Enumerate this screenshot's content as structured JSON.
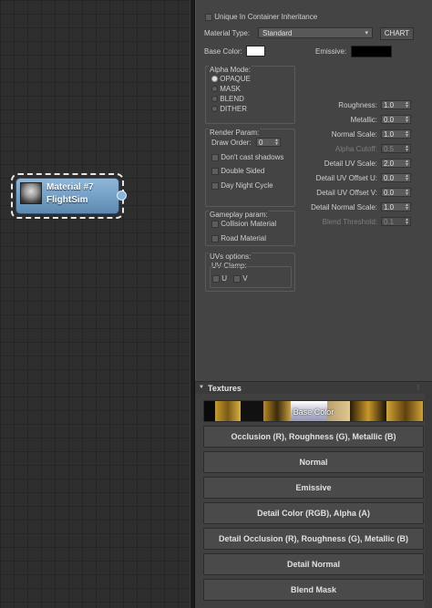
{
  "node": {
    "line1": "Material #7",
    "line2": "FlightSim"
  },
  "panel": {
    "unique_label": "Unique In Container Inheritance",
    "material_type_label": "Material Type:",
    "material_type_value": "Standard",
    "chart_button": "CHART",
    "base_color_label": "Base Color:",
    "base_color": "#ffffff",
    "emissive_label": "Emissive:",
    "emissive_color": "#000000",
    "alpha_mode": {
      "title": "Alpha Mode:",
      "options": [
        "OPAQUE",
        "MASK",
        "BLEND",
        "DITHER"
      ],
      "selected": "OPAQUE"
    },
    "render_param": {
      "title": "Render Param:",
      "draw_order_label": "Draw Order:",
      "draw_order_value": "0",
      "checks": [
        "Don't cast shadows",
        "Double Sided",
        "Day Night Cycle"
      ]
    },
    "gameplay_param": {
      "title": "Gameplay param:",
      "checks": [
        "Collision Material",
        "Road Material"
      ]
    },
    "uv_options": {
      "title": "UVs options:",
      "clamp_title": "UV Clamp:",
      "u_label": "U",
      "v_label": "V"
    },
    "params": [
      {
        "label": "Roughness:",
        "value": "1.0",
        "enabled": true
      },
      {
        "label": "Metallic:",
        "value": "0.0",
        "enabled": true
      },
      {
        "label": "Normal Scale:",
        "value": "1.0",
        "enabled": true
      },
      {
        "label": "Alpha Cutoff:",
        "value": "0.5",
        "enabled": false
      },
      {
        "label": "Detail UV Scale:",
        "value": "2.0",
        "enabled": true
      },
      {
        "label": "Detail UV Offset U:",
        "value": "0.0",
        "enabled": true
      },
      {
        "label": "Detail UV Offset V:",
        "value": "0.0",
        "enabled": true
      },
      {
        "label": "Detail Normal Scale:",
        "value": "1.0",
        "enabled": true
      },
      {
        "label": "Blend Threshold:",
        "value": "0.1",
        "enabled": false
      }
    ]
  },
  "textures": {
    "title": "Textures",
    "base_color_slot": "Base Color",
    "slots": [
      "Occlusion (R), Roughness (G), Metallic (B)",
      "Normal",
      "Emissive",
      "Detail Color (RGB), Alpha (A)",
      "Detail Occlusion (R), Roughness (G), Metallic (B)",
      "Detail Normal",
      "Blend Mask"
    ]
  }
}
